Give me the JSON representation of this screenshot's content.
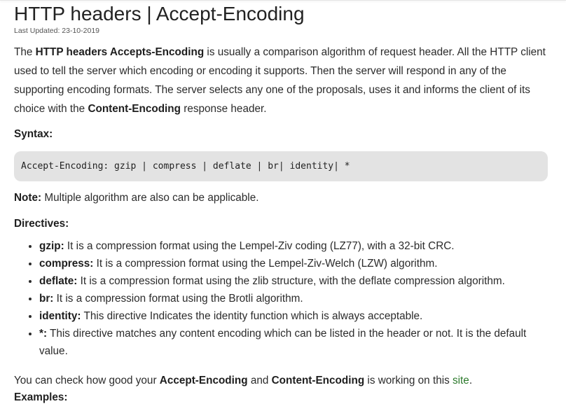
{
  "article": {
    "title": "HTTP headers | Accept-Encoding",
    "last_updated": "Last Updated: 23-10-2019",
    "intro": {
      "t1": "The ",
      "b1": "HTTP headers Accepts-Encoding",
      "t2": " is usually a comparison algorithm of request header. All the HTTP client used to tell the server which encoding or encoding it supports. Then the server will respond in any of the supporting encoding formats. The server selects any one of the proposals, uses it and informs the client of its choice with the ",
      "b2": "Content-Encoding",
      "t3": " response header."
    },
    "syntax_label": "Syntax:",
    "syntax_code": "Accept-Encoding: gzip | compress | deflate | br| identity| *",
    "note": {
      "label": "Note:",
      "text": " Multiple algorithm are also can be applicable."
    },
    "directives_label": "Directives:",
    "directives": [
      {
        "term": "gzip:",
        "desc": " It is a compression format using the Lempel-Ziv coding (LZ77), with a 32-bit CRC."
      },
      {
        "term": "compress:",
        "desc": " It is a compression format using the Lempel-Ziv-Welch (LZW) algorithm."
      },
      {
        "term": "deflate:",
        "desc": " It is a compression format using the zlib structure, with the deflate compression algorithm."
      },
      {
        "term": "br:",
        "desc": " It is a compression format using the Brotli algorithm."
      },
      {
        "term": "identity:",
        "desc": " This directive Indicates the identity function which is always acceptable."
      },
      {
        "term": "*:",
        "desc": " This directive matches any content encoding which can be listed in the header or not. It is the default value."
      }
    ],
    "closing": {
      "t1": "You can check how good your ",
      "b1": "Accept-Encoding",
      "t2": " and ",
      "b2": "Content-Encoding",
      "t3": " is working on this ",
      "link": "site",
      "t4": "."
    },
    "next_heading_partial": "Examples:"
  },
  "colors": {
    "text": "#2b2b2b",
    "code_bg": "#e3e3e3",
    "link": "#2c7a2c"
  }
}
